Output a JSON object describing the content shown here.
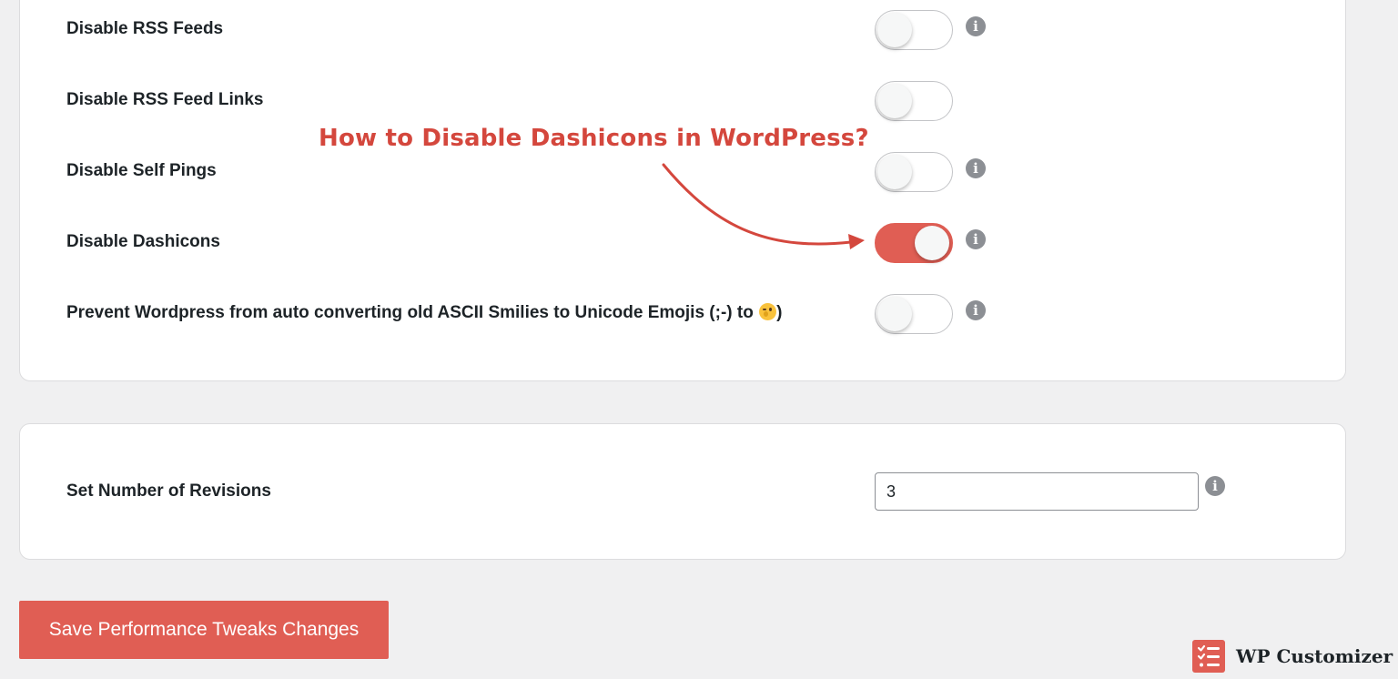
{
  "settings": {
    "rows": [
      {
        "label": "Disable RSS Feeds",
        "enabled": false,
        "has_info": true
      },
      {
        "label": "Disable RSS Feed Links",
        "enabled": false,
        "has_info": false
      },
      {
        "label": "Disable Self Pings",
        "enabled": false,
        "has_info": true
      },
      {
        "label": "Disable Dashicons",
        "enabled": true,
        "has_info": true
      },
      {
        "label": "Prevent Wordpress from auto converting old ASCII Smilies to Unicode Emojis (;-) to",
        "emoji": "winking-face-emoji",
        "label_end": ")",
        "enabled": false,
        "has_info": true
      }
    ],
    "info_icon": "info-icon"
  },
  "revisions": {
    "label": "Set Number of Revisions",
    "value": "3"
  },
  "save_button": {
    "label": "Save Performance Tweaks Changes"
  },
  "annotation": {
    "text": "How to Disable Dashicons in WordPress?",
    "arrow_icon": "curved-arrow-icon"
  },
  "brand": {
    "name": "WP Customizer",
    "logo_icon": "checklist-icon"
  },
  "colors": {
    "accent": "#e05e54",
    "annotation": "#d4473d",
    "page_background": "#f0f0f1",
    "card_background": "#ffffff",
    "info_icon": "#8c8f94"
  }
}
